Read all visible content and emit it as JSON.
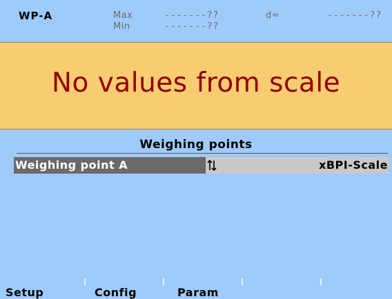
{
  "header": {
    "weighing_point": "WP-A",
    "max_label": "Max",
    "max_value": "-------??",
    "min_label": "Min",
    "min_value": "-------??",
    "d_label": "d=",
    "d_value": "-------??"
  },
  "message": {
    "text": "No values from scale",
    "background": "#f8cc71",
    "color": "#8f0000"
  },
  "section": {
    "title": "Weighing points",
    "rows": [
      {
        "name": "Weighing point A",
        "icon": "up-down-arrows-icon",
        "value": "xBPI-Scale"
      }
    ]
  },
  "softkeys": {
    "setup": "Setup",
    "config": "Config",
    "param": "Param",
    "key4": "",
    "key5": ""
  },
  "colors": {
    "background": "#9fcbfb",
    "selected_row": "#6a6a6a",
    "value_cell": "#c9c9c9"
  }
}
